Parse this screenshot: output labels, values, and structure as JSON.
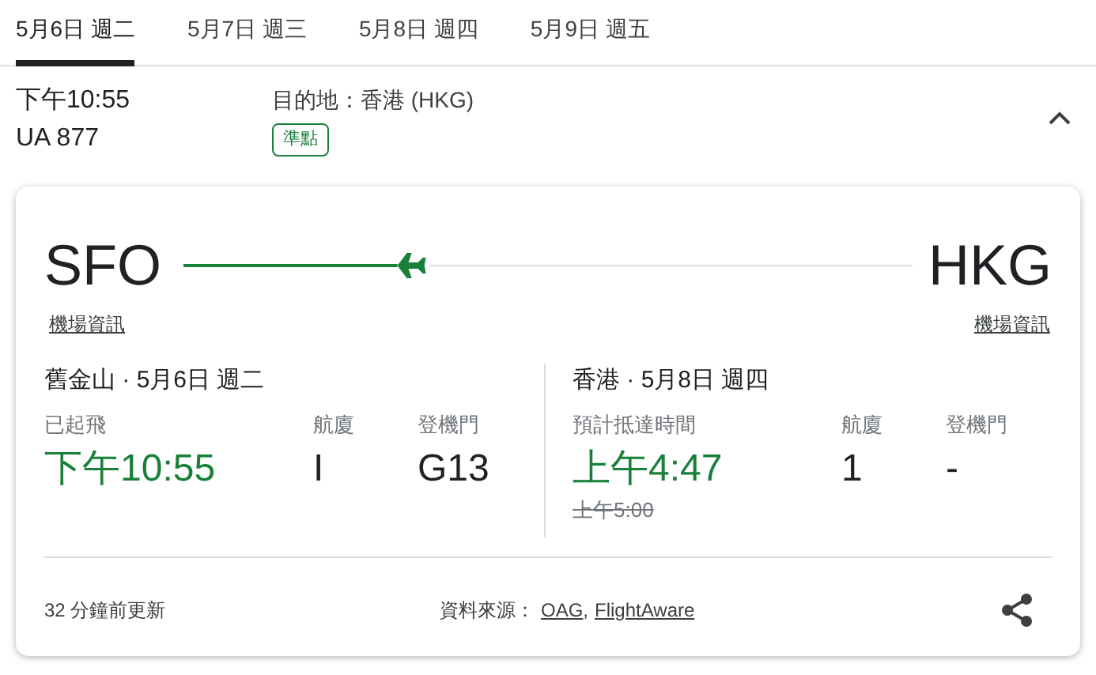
{
  "tabs": [
    {
      "label": "5月6日 週二",
      "selected": true
    },
    {
      "label": "5月7日 週三",
      "selected": false
    },
    {
      "label": "5月8日 週四",
      "selected": false
    },
    {
      "label": "5月9日 週五",
      "selected": false
    }
  ],
  "flight": {
    "time": "下午10:55",
    "number": "UA 877",
    "destination": "目的地：香港 (HKG)",
    "status": "準點",
    "expanded": true
  },
  "route": {
    "origin": "SFO",
    "destination": "HKG",
    "origin_link": "機場資訊",
    "destination_link": "機場資訊"
  },
  "departure": {
    "heading": "舊金山 · 5月6日 週二",
    "status_label": "已起飛",
    "time": "下午10:55",
    "terminal_label": "航廈",
    "terminal": "I",
    "gate_label": "登機門",
    "gate": "G13"
  },
  "arrival": {
    "heading": "香港 · 5月8日 週四",
    "status_label": "預計抵達時間",
    "time": "上午4:47",
    "scheduled_time": "上午5:00",
    "terminal_label": "航廈",
    "terminal": "1",
    "gate_label": "登機門",
    "gate": "-"
  },
  "footer": {
    "updated": "32 分鐘前更新",
    "source_label": "資料來源：",
    "sources": [
      "OAG",
      "FlightAware"
    ],
    "separator": ","
  }
}
